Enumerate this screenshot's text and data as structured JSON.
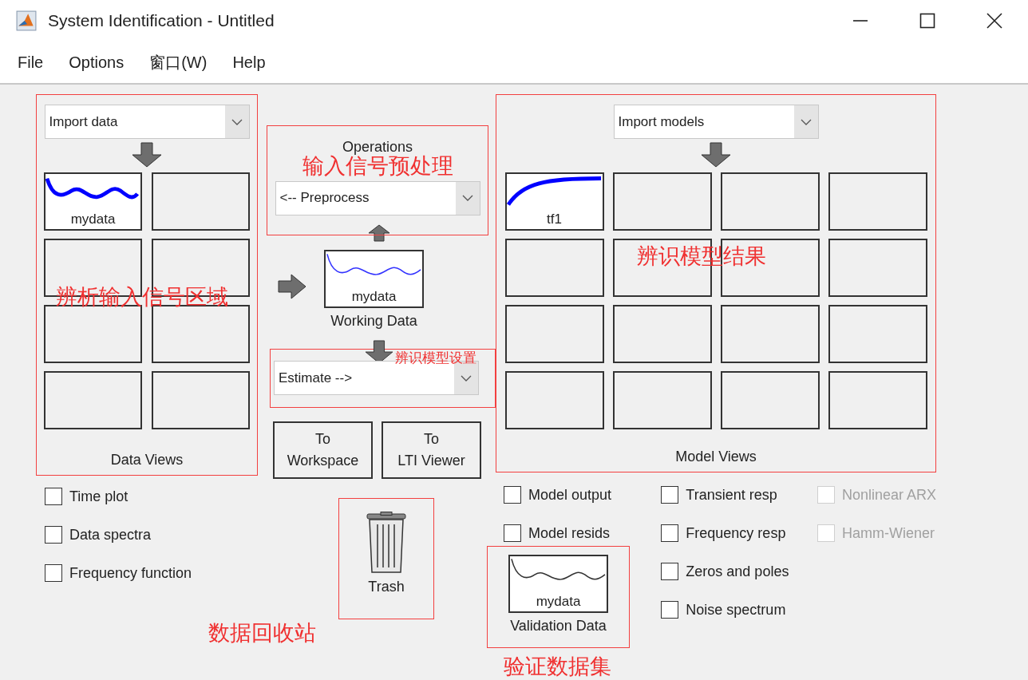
{
  "window": {
    "title": "System Identification - Untitled"
  },
  "menu": [
    "File",
    "Options",
    "窗口(W)",
    "Help"
  ],
  "data_panel": {
    "dropdown": "Import data",
    "label": "Data Views",
    "annotation": "辨析输入信号区域",
    "tiles": [
      {
        "kind": "data",
        "label": "mydata"
      },
      {
        "kind": "empty"
      },
      {
        "kind": "empty"
      },
      {
        "kind": "empty"
      },
      {
        "kind": "empty"
      },
      {
        "kind": "empty"
      },
      {
        "kind": "empty"
      },
      {
        "kind": "empty"
      }
    ]
  },
  "data_checkboxes": [
    {
      "label": "Time plot",
      "checked": false,
      "disabled": false
    },
    {
      "label": "Data spectra",
      "checked": false,
      "disabled": false
    },
    {
      "label": "Frequency function",
      "checked": false,
      "disabled": false
    }
  ],
  "trash_annotation": "数据回收站",
  "operations": {
    "label": "Operations",
    "annotation": "输入信号预处理",
    "dropdown": "<-- Preprocess"
  },
  "working_data": {
    "name": "mydata",
    "label": "Working Data"
  },
  "estimate": {
    "dropdown": "Estimate -->",
    "annotation": "辨识模型设置"
  },
  "buttons": [
    {
      "lines": [
        "To",
        "Workspace"
      ]
    },
    {
      "lines": [
        "To",
        "LTI Viewer"
      ]
    }
  ],
  "trash": {
    "label": "Trash"
  },
  "model_panel": {
    "dropdown": "Import models",
    "label": "Model Views",
    "annotation": "辨识模型结果",
    "tiles": [
      {
        "kind": "model",
        "label": "tf1"
      },
      {
        "kind": "empty"
      },
      {
        "kind": "empty"
      },
      {
        "kind": "empty"
      },
      {
        "kind": "empty"
      },
      {
        "kind": "empty"
      },
      {
        "kind": "empty"
      },
      {
        "kind": "empty"
      },
      {
        "kind": "empty"
      },
      {
        "kind": "empty"
      },
      {
        "kind": "empty"
      },
      {
        "kind": "empty"
      },
      {
        "kind": "empty"
      },
      {
        "kind": "empty"
      },
      {
        "kind": "empty"
      },
      {
        "kind": "empty"
      }
    ]
  },
  "model_checkbox_columns": [
    [
      {
        "label": "Model output",
        "checked": false,
        "disabled": false
      },
      {
        "label": "Model resids",
        "checked": false,
        "disabled": false
      }
    ],
    [
      {
        "label": "Transient resp",
        "checked": false,
        "disabled": false
      },
      {
        "label": "Frequency resp",
        "checked": false,
        "disabled": false
      },
      {
        "label": "Zeros and poles",
        "checked": false,
        "disabled": false
      },
      {
        "label": "Noise spectrum",
        "checked": false,
        "disabled": false
      }
    ],
    [
      {
        "label": "Nonlinear ARX",
        "checked": false,
        "disabled": true
      },
      {
        "label": "Hamm-Wiener",
        "checked": false,
        "disabled": true
      }
    ]
  ],
  "validation": {
    "name": "mydata",
    "label": "Validation Data",
    "annotation": "验证数据集"
  }
}
